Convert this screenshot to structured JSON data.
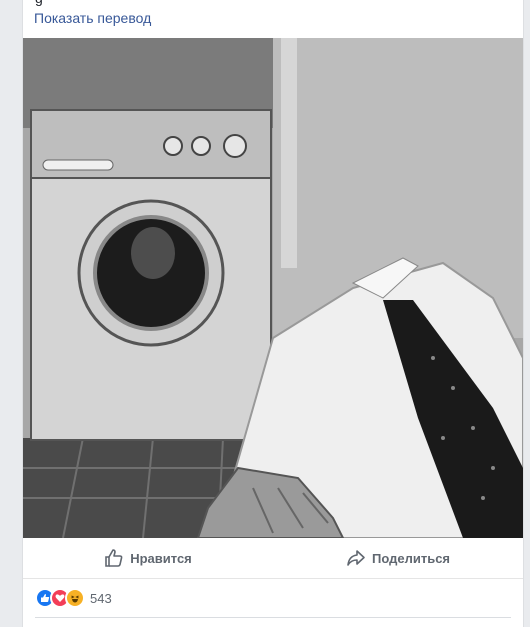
{
  "post": {
    "translate_link": "Показать перевод",
    "photo_icon": "image-icon"
  },
  "actions": {
    "like_label": "Нравится",
    "like_icon": "thumbs-up-icon",
    "share_label": "Поделиться",
    "share_icon": "share-arrow-icon"
  },
  "reactions": {
    "types": [
      "like",
      "love",
      "haha"
    ],
    "count": "543"
  },
  "colors": {
    "link": "#385898",
    "action_text": "#606770",
    "like": "#1877f2",
    "love": "#f33e58",
    "haha": "#f7b125"
  }
}
